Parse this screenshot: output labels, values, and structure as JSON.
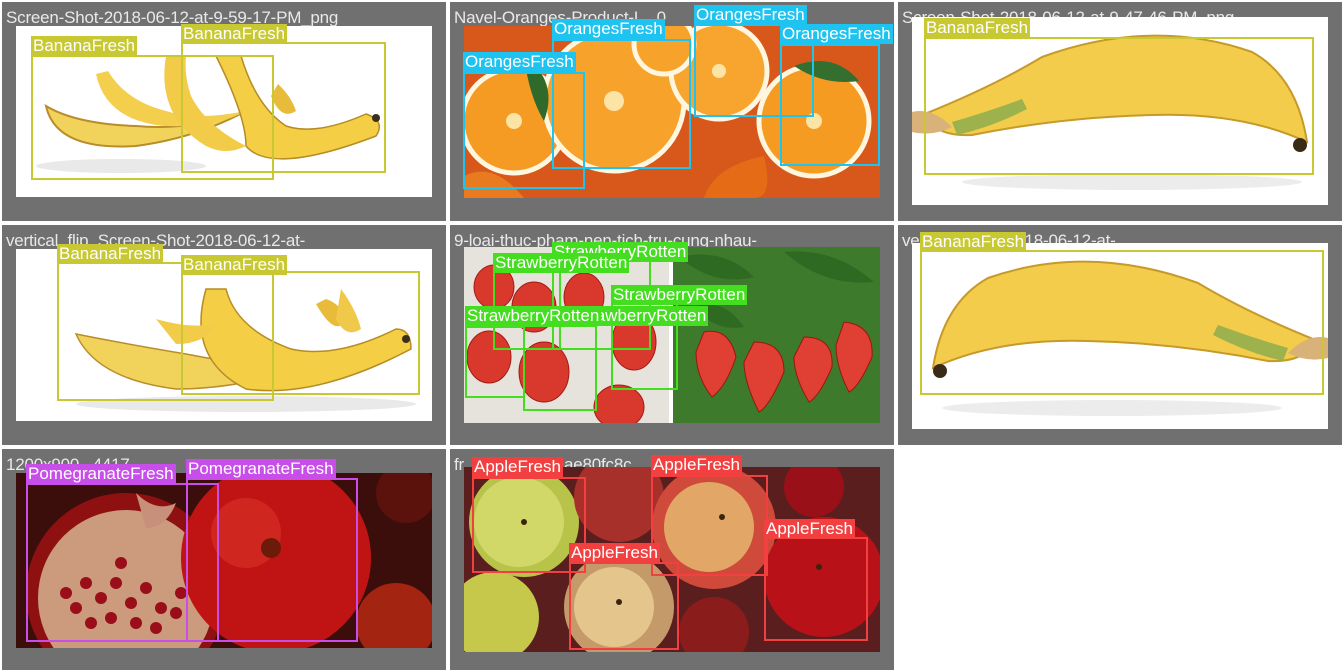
{
  "colors": {
    "tile_bg": "#707070",
    "BananaFresh": "#c8c832",
    "OrangesFresh": "#1ec3ef",
    "StrawberryRotten": "#44dd20",
    "PomegranateFresh": "#c74ee8",
    "AppleFresh": "#f24040"
  },
  "tiles": [
    {
      "title": "Screen-Shot-2018-06-12-at-9-59-17-PM_png",
      "scene": "three-bananas",
      "labels": [
        "BananaFresh",
        "BananaFresh"
      ]
    },
    {
      "title": "Navel-Oranges-Product-L...0",
      "scene": "orange-slices",
      "labels": [
        "OrangesFresh",
        "OrangesFresh",
        "OrangesFresh",
        "OrangesFresh"
      ]
    },
    {
      "title": "Screen-Shot-2018-06-12-at-9-47-46-PM_png",
      "scene": "single-banana",
      "labels": [
        "BananaFresh"
      ]
    },
    {
      "title": "vertical_flip_Screen-Shot-2018-06-12-at-",
      "scene": "three-bananas",
      "labels": [
        "BananaFresh",
        "BananaFresh"
      ]
    },
    {
      "title": "9-loai-thuc-pham-nen-tich-tru-cung-nhau-",
      "scene": "strawberries",
      "labels": [
        "StrawberryRotten",
        "StrawberryRotten",
        "StrawberryRotten",
        "StrawberryRotten",
        "StrawberryRotten"
      ]
    },
    {
      "title": "ve...een-Shot-2018-06-12-at-",
      "scene": "single-banana-flipped",
      "labels": [
        "BananaFresh"
      ]
    },
    {
      "title": "1200x900...4417",
      "scene": "pomegranates",
      "labels": [
        "PomegranateFresh",
        "PomegranateFresh"
      ]
    },
    {
      "title": "fr...06-cf412...aae80fc8c",
      "scene": "apples",
      "labels": [
        "AppleFresh",
        "AppleFresh",
        "AppleFresh",
        "AppleFresh"
      ]
    }
  ]
}
